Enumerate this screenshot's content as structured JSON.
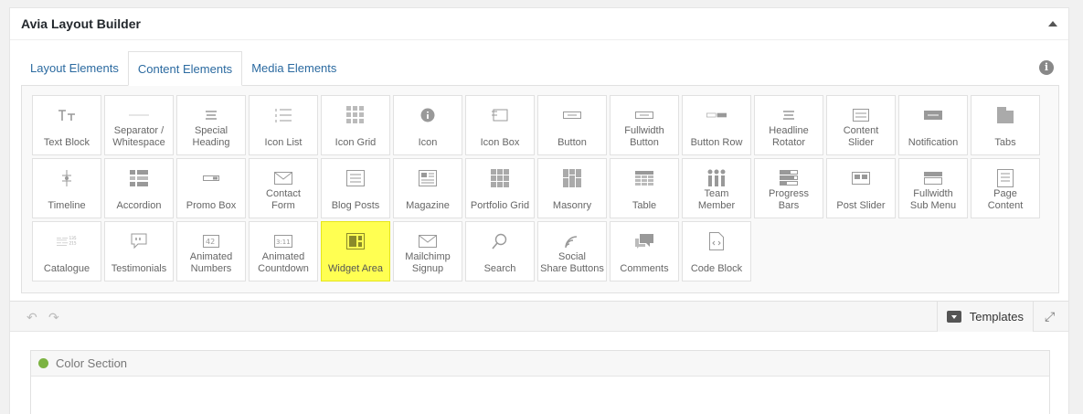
{
  "panel": {
    "title": "Avia Layout Builder"
  },
  "tabs": [
    {
      "label": "Layout Elements",
      "active": false
    },
    {
      "label": "Content Elements",
      "active": true
    },
    {
      "label": "Media Elements",
      "active": false
    }
  ],
  "info_icon": "i",
  "elements": [
    {
      "label": "Text Block",
      "icon": "text-icon"
    },
    {
      "label": "Separator / Whitespace",
      "icon": "separator-icon"
    },
    {
      "label": "Special Heading",
      "icon": "heading-icon"
    },
    {
      "label": "Icon List",
      "icon": "list-icon"
    },
    {
      "label": "Icon Grid",
      "icon": "grid-icon"
    },
    {
      "label": "Icon",
      "icon": "info-circle-icon"
    },
    {
      "label": "Icon Box",
      "icon": "box-icon"
    },
    {
      "label": "Button",
      "icon": "button-icon"
    },
    {
      "label": "Fullwidth Button",
      "icon": "fullwidth-button-icon"
    },
    {
      "label": "Button Row",
      "icon": "button-row-icon"
    },
    {
      "label": "Headline Rotator",
      "icon": "rotator-icon"
    },
    {
      "label": "Content Slider",
      "icon": "slider-icon"
    },
    {
      "label": "Notification",
      "icon": "notification-icon"
    },
    {
      "label": "Tabs",
      "icon": "tabs-icon"
    },
    {
      "label": "Timeline",
      "icon": "timeline-icon"
    },
    {
      "label": "Accordion",
      "icon": "accordion-icon"
    },
    {
      "label": "Promo Box",
      "icon": "promo-icon"
    },
    {
      "label": "Contact Form",
      "icon": "envelope-icon"
    },
    {
      "label": "Blog Posts",
      "icon": "blog-icon"
    },
    {
      "label": "Magazine",
      "icon": "magazine-icon"
    },
    {
      "label": "Portfolio Grid",
      "icon": "portfolio-icon"
    },
    {
      "label": "Masonry",
      "icon": "masonry-icon"
    },
    {
      "label": "Table",
      "icon": "table-icon"
    },
    {
      "label": "Team Member",
      "icon": "team-icon"
    },
    {
      "label": "Progress Bars",
      "icon": "progress-icon"
    },
    {
      "label": "Post Slider",
      "icon": "post-slider-icon"
    },
    {
      "label": "Fullwidth Sub Menu",
      "icon": "submenu-icon"
    },
    {
      "label": "Page Content",
      "icon": "page-icon"
    },
    {
      "label": "Catalogue",
      "icon": "catalogue-icon"
    },
    {
      "label": "Testimonials",
      "icon": "quote-icon"
    },
    {
      "label": "Animated Numbers",
      "icon": "numbers-icon"
    },
    {
      "label": "Animated Countdown",
      "icon": "countdown-icon"
    },
    {
      "label": "Widget Area",
      "icon": "widget-icon",
      "highlight": true
    },
    {
      "label": "Mailchimp Signup",
      "icon": "mail-icon"
    },
    {
      "label": "Search",
      "icon": "search-icon"
    },
    {
      "label": "Social Share Buttons",
      "icon": "share-icon"
    },
    {
      "label": "Comments",
      "icon": "comments-icon"
    },
    {
      "label": "Code Block",
      "icon": "code-icon"
    }
  ],
  "toolbar": {
    "templates_label": "Templates"
  },
  "canvas": {
    "section_label": "Color Section",
    "section_color": "#7cb342"
  },
  "colors": {
    "highlight": "#ffff52",
    "link": "#2b6aa0"
  }
}
